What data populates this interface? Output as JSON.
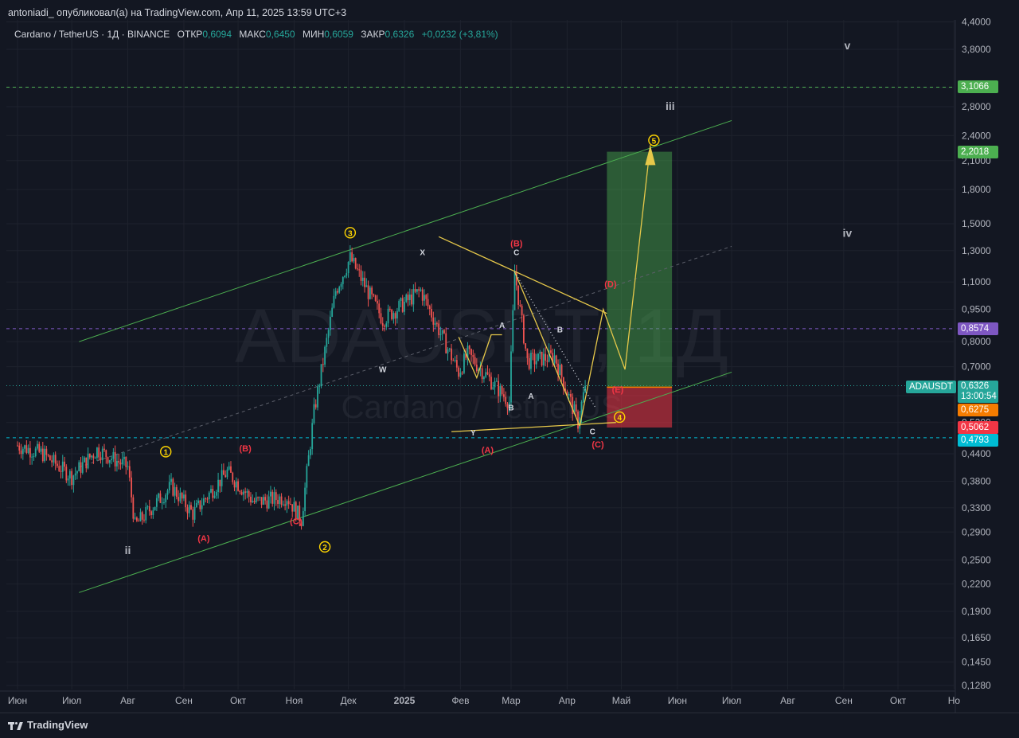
{
  "header": {
    "publish_line": "antoniadi_ опубликовал(а) на TradingView.com, Апр 11, 2025 13:59 UTC+3"
  },
  "legend": {
    "symbol": "Cardano / TetherUS · 1Д · BINANCE",
    "open_label": "ОТКР",
    "open_value": "0,6094",
    "high_label": "МАКС",
    "high_value": "0,6450",
    "low_label": "МИН",
    "low_value": "0,6059",
    "close_label": "ЗАКР",
    "close_value": "0,6326",
    "change": "+0,0232 (+3,81%)"
  },
  "watermark": {
    "ticker": "ADAUSDT, 1Д",
    "name": "Cardano / TetherUS"
  },
  "footer": {
    "brand": "TradingView"
  },
  "price_badges": {
    "symbol": "ADAUSDT",
    "current": "0,6326",
    "countdown": "13:00:54",
    "target": "3,1066",
    "take_profit": "2,2018",
    "level_purple": "0,8574",
    "entry": "0,6275",
    "stop": "0,5062",
    "level_cyan": "0,4793",
    "colors": {
      "green": "#4caf50",
      "purple": "#7e57c2",
      "orange": "#f57c00",
      "red": "#f23645",
      "cyan": "#00bcd4",
      "teal": "#26a69a"
    }
  },
  "chart_data": {
    "type": "candlestick",
    "scale": "log",
    "ylim": [
      0.128,
      4.0
    ],
    "y_ticks": [
      "4,4000",
      "3,8000",
      "3,1000",
      "2,8000",
      "2,4000",
      "2,1000",
      "1,8000",
      "1,5000",
      "1,3000",
      "1,1000",
      "0,9500",
      "0,8000",
      "0,7000",
      "0,6000",
      "0,5200",
      "0,4400",
      "0,3800",
      "0,3300",
      "0,2900",
      "0,2500",
      "0,2200",
      "0,1900",
      "0,1650",
      "0,1450",
      "0,1280"
    ],
    "x_ticks": [
      "Июн",
      "Июл",
      "Авг",
      "Сен",
      "Окт",
      "Ноя",
      "Дек",
      "2025",
      "Фев",
      "Мар",
      "Апр",
      "Май",
      "Июн",
      "Июл",
      "Авг",
      "Сен",
      "Окт",
      "Но"
    ],
    "price_path": [
      [
        "2024-06-01",
        0.46
      ],
      [
        "2024-06-15",
        0.44
      ],
      [
        "2024-07-01",
        0.39
      ],
      [
        "2024-07-15",
        0.45
      ],
      [
        "2024-08-01",
        0.41
      ],
      [
        "2024-08-05",
        0.3
      ],
      [
        "2024-08-25",
        0.37
      ],
      [
        "2024-09-06",
        0.32
      ],
      [
        "2024-09-25",
        0.4
      ],
      [
        "2024-10-10",
        0.34
      ],
      [
        "2024-10-28",
        0.35
      ],
      [
        "2024-11-05",
        0.31
      ],
      [
        "2024-11-12",
        0.55
      ],
      [
        "2024-11-24",
        1.05
      ],
      [
        "2024-12-02",
        1.25
      ],
      [
        "2024-12-20",
        0.9
      ],
      [
        "2025-01-10",
        1.05
      ],
      [
        "2025-01-31",
        0.68
      ],
      [
        "2025-02-05",
        0.75
      ],
      [
        "2025-02-28",
        0.58
      ],
      [
        "2025-03-03",
        1.16
      ],
      [
        "2025-03-10",
        0.72
      ],
      [
        "2025-03-25",
        0.74
      ],
      [
        "2025-04-07",
        0.52
      ],
      [
        "2025-04-11",
        0.6326
      ]
    ],
    "wave_labels": {
      "primary": [
        "1",
        "2",
        "3",
        "4",
        "5"
      ],
      "roman": [
        "ii",
        "iii",
        "iv",
        "v"
      ],
      "corrective_red": [
        "(A)",
        "(B)",
        "(C)",
        "(A)",
        "(B)",
        "(C)",
        "(D)",
        "(E)"
      ],
      "corrective_white": [
        "W",
        "X",
        "Y",
        "A",
        "B",
        "A",
        "B",
        "C",
        "C"
      ]
    },
    "levels": {
      "target": 3.1066,
      "take_profit": 2.2018,
      "purple": 0.8574,
      "current": 0.6326,
      "entry": 0.6275,
      "stop": 0.5062,
      "cyan": 0.4793
    }
  }
}
